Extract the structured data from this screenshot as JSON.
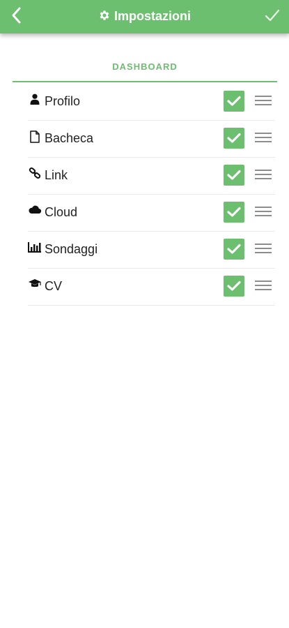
{
  "header": {
    "title": "Impostazioni",
    "back_icon": "chevron-left-icon",
    "title_icon": "gear-icon",
    "confirm_icon": "check-icon",
    "bar_color": "#6cbf6f"
  },
  "section": {
    "title": "DASHBOARD"
  },
  "items": [
    {
      "label": "Profilo",
      "icon": "user-icon",
      "checked": true
    },
    {
      "label": "Bacheca",
      "icon": "document-icon",
      "checked": true
    },
    {
      "label": "Link",
      "icon": "link-icon",
      "checked": true
    },
    {
      "label": "Cloud",
      "icon": "cloud-icon",
      "checked": true
    },
    {
      "label": "Sondaggi",
      "icon": "bar-chart-icon",
      "checked": true
    },
    {
      "label": "CV",
      "icon": "graduation-cap-icon",
      "checked": true
    }
  ],
  "colors": {
    "accent": "#6cbf6f",
    "text": "#222222",
    "divider": "#e9e9e9",
    "drag_handle": "#8d8d8d"
  }
}
